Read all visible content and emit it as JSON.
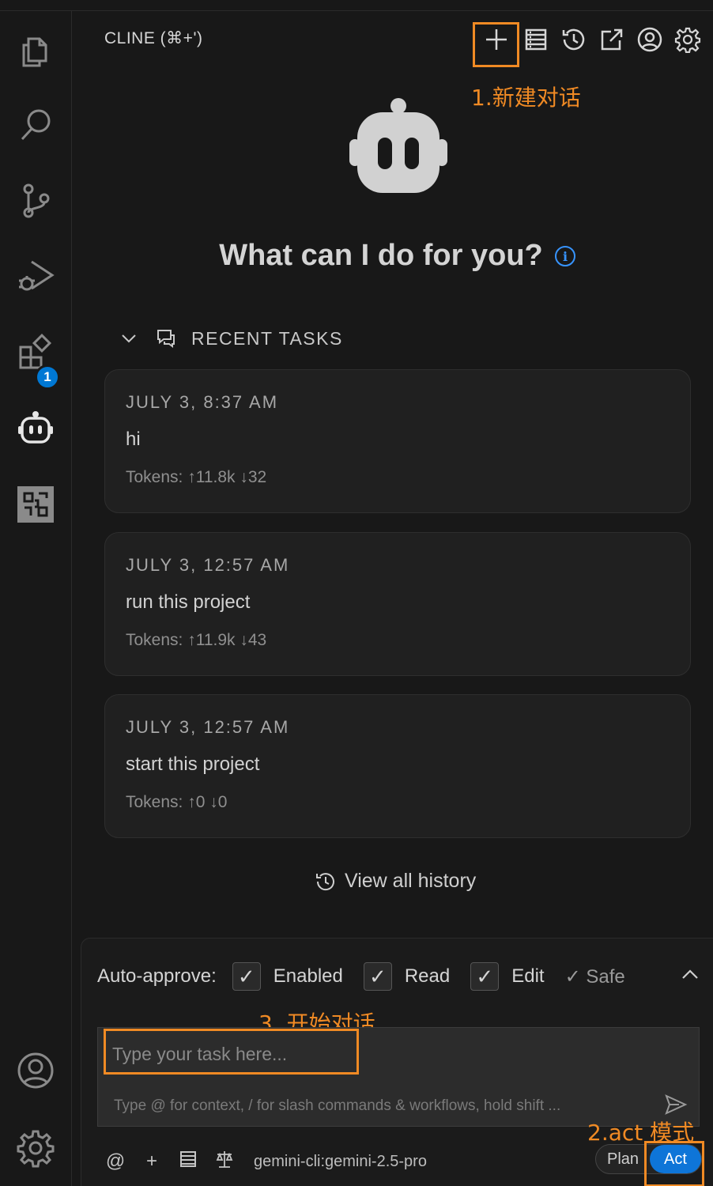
{
  "panel": {
    "title": "CLINE (⌘+')",
    "toolbar": [
      "new-task",
      "mcp-servers",
      "history",
      "popout",
      "account",
      "settings"
    ]
  },
  "activity_bar": {
    "items": [
      "explorer",
      "search",
      "source-control",
      "run-debug",
      "extensions",
      "cline",
      "qr-scanner"
    ],
    "extensions_badge": "1",
    "bottom": [
      "account",
      "settings"
    ]
  },
  "annotations": {
    "new_chat": "1.新建对话",
    "act_mode": "2.act 模式",
    "start_chat": "3. 开始对话",
    "color": "#f08a24"
  },
  "welcome": {
    "headline": "What can I do for you?"
  },
  "recent": {
    "label": "RECENT TASKS",
    "tasks": [
      {
        "date": "JULY 3, 8:37 AM",
        "task": "hi",
        "tokens": "Tokens: ↑11.8k ↓32"
      },
      {
        "date": "JULY 3, 12:57 AM",
        "task": "run this project",
        "tokens": "Tokens: ↑11.9k ↓43"
      },
      {
        "date": "JULY 3, 12:57 AM",
        "task": "start this project",
        "tokens": "Tokens: ↑0 ↓0"
      }
    ],
    "view_all": "View all history"
  },
  "auto_approve": {
    "label": "Auto-approve:",
    "enabled": "Enabled",
    "read": "Read",
    "edit": "Edit",
    "safe": "✓ Safe"
  },
  "input": {
    "placeholder": "Type your task here...",
    "hint": "Type @ for context, / for slash commands & workflows, hold shift ..."
  },
  "footer": {
    "at": "@",
    "plus": "+",
    "model": "gemini-cli:gemini-2.5-pro",
    "plan": "Plan",
    "act": "Act",
    "accent": "#0e75d8"
  }
}
